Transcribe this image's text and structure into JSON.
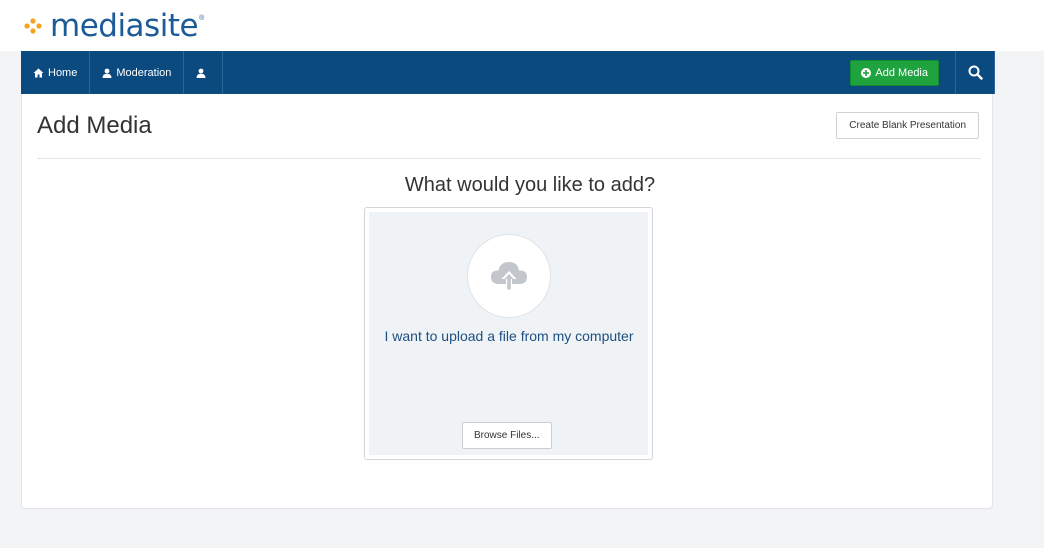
{
  "brand": {
    "name": "mediasite",
    "reg_mark": "®",
    "color": "#1c5b97",
    "dot_color": "#f5a31a"
  },
  "nav": {
    "items": [
      {
        "label": "Home",
        "icon": "home-icon"
      },
      {
        "label": "Moderation",
        "icon": "user-icon"
      },
      {
        "label": "",
        "icon": "user-icon"
      }
    ],
    "add_media_label": "Add Media",
    "search_icon": "search-icon",
    "bg_color": "#0a4a7f",
    "accent_color": "#1ea33f"
  },
  "page": {
    "title": "Add Media",
    "create_blank_label": "Create Blank Presentation",
    "question": "What would you like to add?"
  },
  "upload": {
    "text": "I want to upload a file from my computer",
    "browse_label": "Browse Files...",
    "icon": "cloud-upload-icon"
  }
}
